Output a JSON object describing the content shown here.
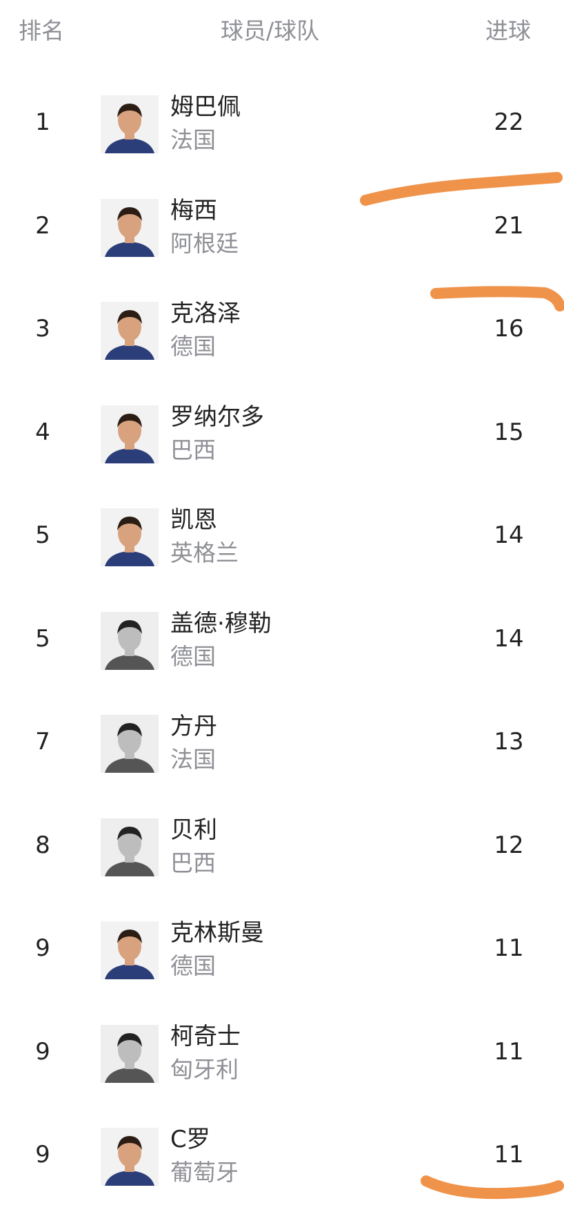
{
  "header": {
    "rank_label": "排名",
    "player_label": "球员/球队",
    "goals_label": "进球"
  },
  "players": [
    {
      "rank": "1",
      "name": "姆巴佩",
      "team": "法国",
      "goals": "22",
      "photo": "color"
    },
    {
      "rank": "2",
      "name": "梅西",
      "team": "阿根廷",
      "goals": "21",
      "photo": "color"
    },
    {
      "rank": "3",
      "name": "克洛泽",
      "team": "德国",
      "goals": "16",
      "photo": "color"
    },
    {
      "rank": "4",
      "name": "罗纳尔多",
      "team": "巴西",
      "goals": "15",
      "photo": "color"
    },
    {
      "rank": "5",
      "name": "凯恩",
      "team": "英格兰",
      "goals": "14",
      "photo": "color"
    },
    {
      "rank": "5",
      "name": "盖德·穆勒",
      "team": "德国",
      "goals": "14",
      "photo": "bw"
    },
    {
      "rank": "7",
      "name": "方丹",
      "team": "法国",
      "goals": "13",
      "photo": "bw"
    },
    {
      "rank": "8",
      "name": "贝利",
      "team": "巴西",
      "goals": "12",
      "photo": "bw"
    },
    {
      "rank": "9",
      "name": "克林斯曼",
      "team": "德国",
      "goals": "11",
      "photo": "color"
    },
    {
      "rank": "9",
      "name": "柯奇士",
      "team": "匈牙利",
      "goals": "11",
      "photo": "bw"
    },
    {
      "rank": "9",
      "name": "C罗",
      "team": "葡萄牙",
      "goals": "11",
      "photo": "color"
    }
  ],
  "annotation_color": "#f0934a"
}
